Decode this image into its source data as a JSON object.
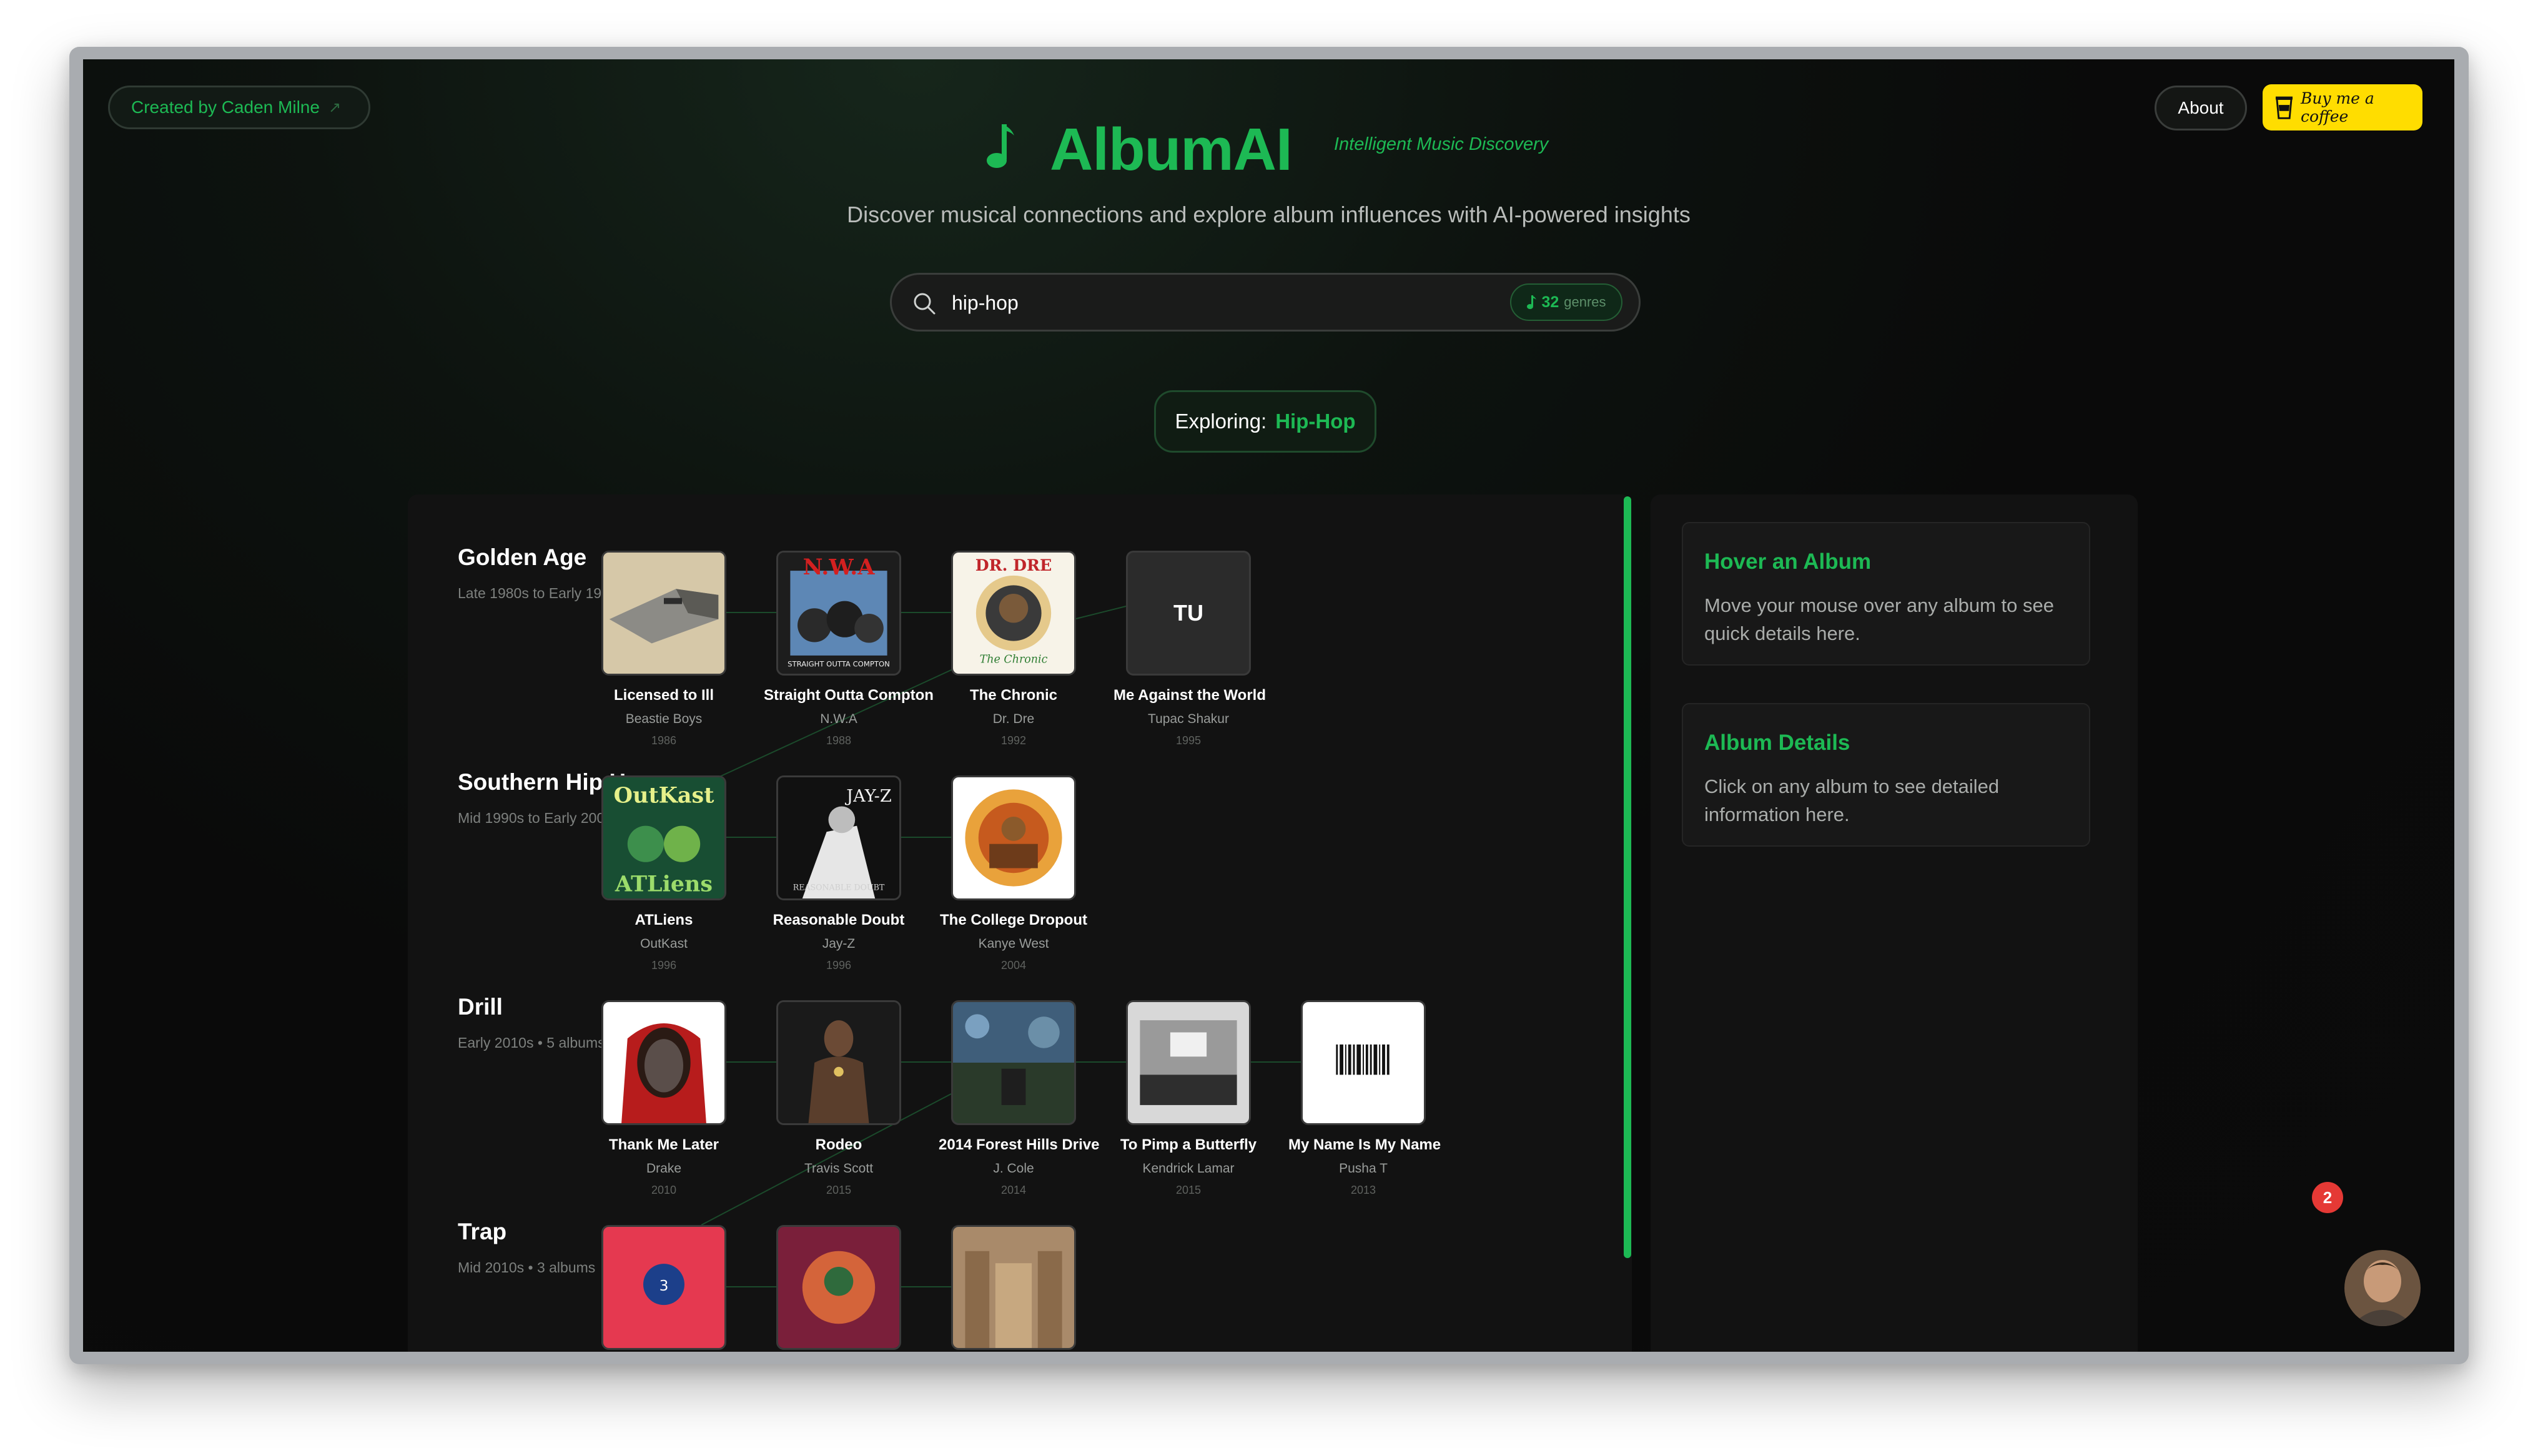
{
  "header": {
    "credit_label": "Created by Caden Milne",
    "credit_icon": "external-link-icon",
    "about_label": "About",
    "coffee_label": "Buy me a coffee",
    "logo_title": "AlbumAI",
    "logo_icon": "music-note-icon",
    "logo_tagline": "Intelligent Music Discovery",
    "subtitle": "Discover musical connections and explore album influences with AI-powered insights"
  },
  "search": {
    "value": "hip-hop",
    "placeholder": "",
    "genre_count": "32",
    "genre_label": "genres"
  },
  "exploring": {
    "label": "Exploring:",
    "value": "Hip-Hop"
  },
  "eras": [
    {
      "name": "Golden Age",
      "meta": "Late 1980s to Early 1990s • 4 albums",
      "albums": [
        {
          "title": "Licensed to Ill",
          "artist": "Beastie Boys",
          "year": "1986"
        },
        {
          "title": "Straight Outta Compton",
          "artist": "N.W.A",
          "year": "1988"
        },
        {
          "title": "The Chronic",
          "artist": "Dr. Dre",
          "year": "1992"
        },
        {
          "title": "Me Against the World",
          "artist": "Tupac Shakur",
          "year": "1995",
          "initials": "TU"
        }
      ]
    },
    {
      "name": "Southern Hip Hop",
      "meta": "Mid 1990s to Early 2000s • 3 albums",
      "albums": [
        {
          "title": "ATLiens",
          "artist": "OutKast",
          "year": "1996"
        },
        {
          "title": "Reasonable Doubt",
          "artist": "Jay-Z",
          "year": "1996"
        },
        {
          "title": "The College Dropout",
          "artist": "Kanye West",
          "year": "2004"
        }
      ]
    },
    {
      "name": "Drill",
      "meta": "Early 2010s • 5 albums",
      "albums": [
        {
          "title": "Thank Me Later",
          "artist": "Drake",
          "year": "2010"
        },
        {
          "title": "Rodeo",
          "artist": "Travis Scott",
          "year": "2015"
        },
        {
          "title": "2014 Forest Hills Drive",
          "artist": "J. Cole",
          "year": "2014"
        },
        {
          "title": "To Pimp a Butterfly",
          "artist": "Kendrick Lamar",
          "year": "2015"
        },
        {
          "title": "My Name Is My Name",
          "artist": "Pusha T",
          "year": "2013"
        }
      ]
    },
    {
      "name": "Trap",
      "meta": "Mid 2010s • 3 albums",
      "albums": [
        {
          "title": "",
          "artist": "",
          "year": ""
        },
        {
          "title": "",
          "artist": "",
          "year": ""
        },
        {
          "title": "",
          "artist": "",
          "year": ""
        }
      ]
    }
  ],
  "side_panel": {
    "hover_title": "Hover an Album",
    "hover_body": "Move your mouse over any album to see quick details here.",
    "details_title": "Album Details",
    "details_body": "Click on any album to see detailed information here."
  },
  "chat_widget": {
    "badge_count": "2"
  },
  "colors": {
    "accent": "#1db954",
    "coffee": "#ffdd00",
    "badge": "#e53935"
  }
}
